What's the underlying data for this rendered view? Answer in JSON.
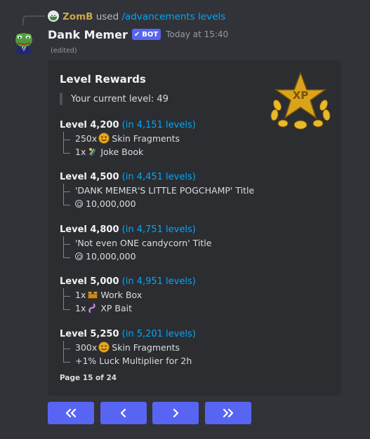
{
  "reply": {
    "username": "ZomB",
    "used_text": "used",
    "command": "/advancements levels"
  },
  "message": {
    "author": "Dank Memer",
    "bot_tag": "BOT",
    "timestamp": "Today at 15:40",
    "edited": "(edited)"
  },
  "embed": {
    "title": "Level Rewards",
    "current_level": "Your current level: 49",
    "thumbnail_text": "XP",
    "footer": "Page 15 of 24",
    "levels": [
      {
        "name": "Level 4,200",
        "remaining": "(in 4,151 levels)",
        "rewards": [
          {
            "qty": "250x",
            "icon": "theater-masks-icon",
            "label": "Skin Fragments"
          },
          {
            "qty": "1x",
            "icon": "joke-book-icon",
            "label": "Joke Book"
          }
        ]
      },
      {
        "name": "Level 4,500",
        "remaining": "(in 4,451 levels)",
        "rewards": [
          {
            "qty": "",
            "icon": "",
            "label": "'DANK MEMER'S LITTLE POGCHAMP' Title"
          },
          {
            "qty": "",
            "icon": "coin-icon",
            "label": "10,000,000"
          }
        ]
      },
      {
        "name": "Level 4,800",
        "remaining": "(in 4,751 levels)",
        "rewards": [
          {
            "qty": "",
            "icon": "",
            "label": "'Not even ONE candycorn' Title"
          },
          {
            "qty": "",
            "icon": "coin-icon",
            "label": "10,000,000"
          }
        ]
      },
      {
        "name": "Level 5,000",
        "remaining": "(in 4,951 levels)",
        "rewards": [
          {
            "qty": "1x",
            "icon": "work-box-icon",
            "label": "Work Box"
          },
          {
            "qty": "1x",
            "icon": "xp-bait-icon",
            "label": "XP Bait"
          }
        ]
      },
      {
        "name": "Level 5,250",
        "remaining": "(in 5,201 levels)",
        "rewards": [
          {
            "qty": "300x",
            "icon": "theater-masks-icon",
            "label": "Skin Fragments"
          },
          {
            "qty": "",
            "icon": "",
            "label": "+1% Luck Multiplier for 2h"
          }
        ]
      }
    ]
  },
  "buttons": [
    {
      "icon": "double-chevron-left-icon"
    },
    {
      "icon": "chevron-left-icon"
    },
    {
      "icon": "chevron-right-icon"
    },
    {
      "icon": "double-chevron-right-icon"
    }
  ],
  "colors": {
    "background": "#313338",
    "embed": "#2b2d31",
    "blurple": "#5865f2",
    "link": "#00a8fc",
    "reply_username": "#c9a84c"
  }
}
